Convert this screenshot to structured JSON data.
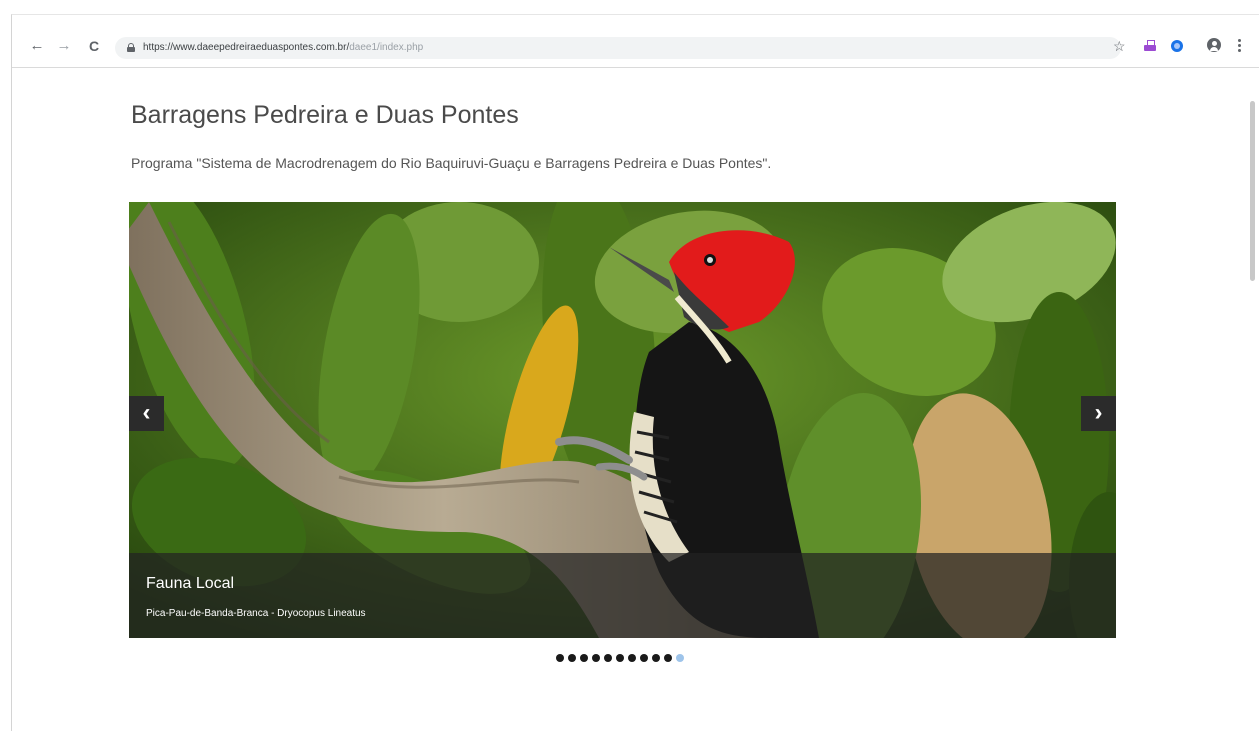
{
  "browser": {
    "url_host": "https://www.daeepedreiraeduaspontes.com.br/",
    "url_path": "daee1/index.php",
    "back_glyph": "←",
    "forward_glyph": "→",
    "reload_glyph": "C",
    "star_glyph": "☆",
    "icons": [
      "back-icon",
      "forward-icon",
      "reload-icon",
      "lock-icon",
      "bookmark-star-icon",
      "extension-icon",
      "extension-icon",
      "account-icon",
      "menu-icon"
    ]
  },
  "page": {
    "title": "Barragens Pedreira e Duas Pontes",
    "subtitle": "Programa \"Sistema de Macrodrenagem do Rio Baquiruvi-Guaçu e Barragens Pedreira e Duas Pontes\"."
  },
  "carousel": {
    "prev_label": "‹",
    "next_label": "›",
    "caption_title": "Fauna Local",
    "caption_text": "Pica-Pau-de-Banda-Branca - Dryocopus Lineatus",
    "slide_count": 11,
    "active_index": 10
  },
  "colors": {
    "caption_bg": "#232323",
    "active_dot": "#9ec4ea",
    "dot": "#1a1a1a"
  }
}
